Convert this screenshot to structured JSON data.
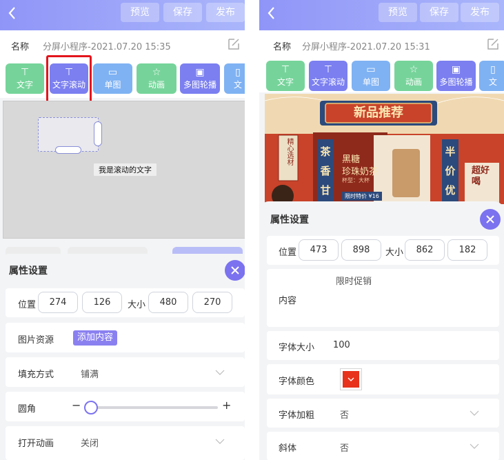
{
  "colors": {
    "header_start": "#8f95f7",
    "header_end": "#aab6fb",
    "green": "#76d49a",
    "purple": "#7b7ff0",
    "blue": "#7fb2f3",
    "accent": "#7b72ef",
    "highlight_red": "#e3141c",
    "font_color_swatch": "#e8321b"
  },
  "header": {
    "preview": "预览",
    "save": "保存",
    "publish": "发布"
  },
  "left": {
    "name_label": "名称",
    "name_value": "分屏小程序-2021.07.20 15:35",
    "tools": [
      {
        "label": "文字",
        "icon": "text-icon"
      },
      {
        "label": "文字滚动",
        "icon": "text-icon"
      },
      {
        "label": "单图",
        "icon": "image-icon"
      },
      {
        "label": "动画",
        "icon": "star-icon"
      },
      {
        "label": "多图轮播",
        "icon": "images-icon"
      },
      {
        "label": "文",
        "icon": "more-icon"
      }
    ],
    "canvas_text": "我是滚动的文字",
    "props_title": "属性设置",
    "position_label": "位置",
    "position_x": "274",
    "position_y": "126",
    "size_label": "大小",
    "size_w": "480",
    "size_h": "270",
    "image_source_label": "图片资源",
    "add_content": "添加内容",
    "fill_label": "填充方式",
    "fill_value": "铺满",
    "radius_label": "圆角",
    "radius_minus": "−",
    "radius_plus": "+",
    "radius_level": 0,
    "open_anim_label": "打开动画",
    "open_anim_value": "关闭"
  },
  "right": {
    "name_label": "名称",
    "name_value": "分屏小程序-2021.07.20 15:31",
    "tools": [
      {
        "label": "文字",
        "icon": "text-icon"
      },
      {
        "label": "文字滚动",
        "icon": "text-icon"
      },
      {
        "label": "单图",
        "icon": "image-icon"
      },
      {
        "label": "动画",
        "icon": "star-icon"
      },
      {
        "label": "多图轮播",
        "icon": "images-icon"
      },
      {
        "label": "文",
        "icon": "more-icon"
      }
    ],
    "poster": {
      "banner": "新品推荐",
      "side_left": "精心选材",
      "left_col": [
        "茶",
        "香",
        "甘"
      ],
      "right_col": [
        "半",
        "价",
        "优"
      ],
      "product_line1": "黑糖",
      "product_line2": "珍珠奶茶",
      "product_sub": "杯型：大杯",
      "badge": "限时特价 ¥16",
      "corner": "超好喝"
    },
    "props_title": "属性设置",
    "position_label": "位置",
    "position_x": "473",
    "position_y": "898",
    "size_label": "大小",
    "size_w": "862",
    "size_h": "182",
    "content_text": "限时促销",
    "content_label": "内容",
    "font_size_label": "字体大小",
    "font_size_value": "100",
    "font_color_label": "字体颜色",
    "bold_label": "字体加粗",
    "bold_value": "否",
    "italic_label": "斜体",
    "italic_value": "否"
  }
}
